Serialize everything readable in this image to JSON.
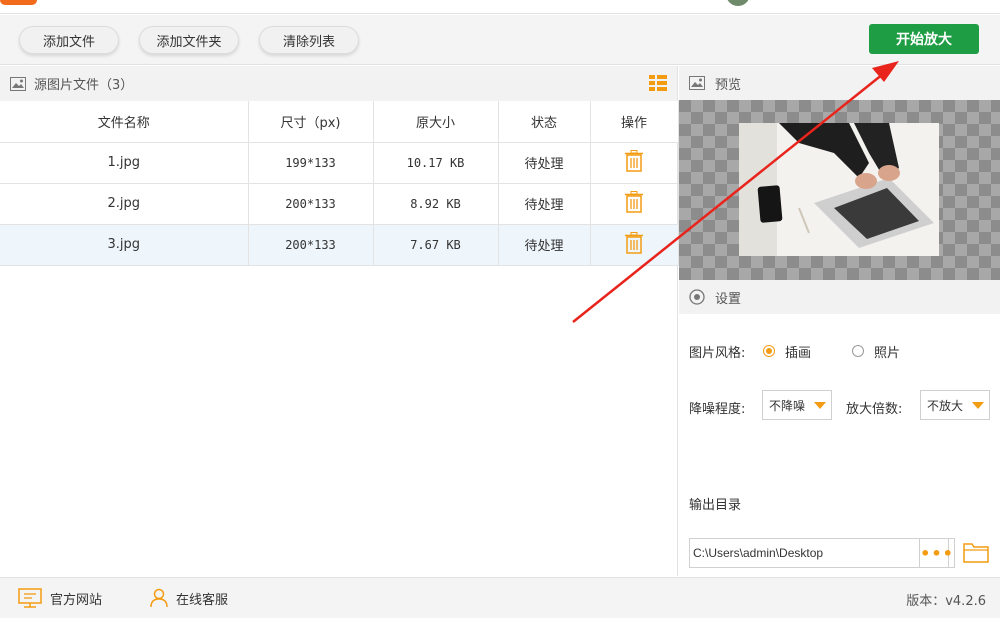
{
  "toolbar": {
    "add_file": "添加文件",
    "add_folder": "添加文件夹",
    "clear_list": "清除列表",
    "start": "开始放大"
  },
  "file_panel": {
    "title": "源图片文件（3）",
    "columns": [
      "文件名称",
      "尺寸（px)",
      "原大小",
      "状态",
      "操作"
    ],
    "rows": [
      {
        "name": "1.jpg",
        "size": "199*133",
        "filesize": "10.17 KB",
        "status": "待处理"
      },
      {
        "name": "2.jpg",
        "size": "200*133",
        "filesize": "8.92 KB",
        "status": "待处理"
      },
      {
        "name": "3.jpg",
        "size": "200*133",
        "filesize": "7.67 KB",
        "status": "待处理"
      }
    ]
  },
  "preview": {
    "title": "预览"
  },
  "settings": {
    "title": "设置",
    "style_label": "图片风格:",
    "style_options": [
      "插画",
      "照片"
    ],
    "style_selected": "插画",
    "noise_label": "降噪程度:",
    "noise_value": "不降噪",
    "scale_label": "放大倍数:",
    "scale_value": "不放大",
    "output_label": "输出目录",
    "output_path": "C:\\Users\\admin\\Desktop",
    "dots": "•••"
  },
  "footer": {
    "website": "官方网站",
    "support": "在线客服",
    "version": "版本：v4.2.6"
  },
  "colors": {
    "accent": "#1f9d44",
    "orange": "#f39c12",
    "arrow": "#e8241c"
  }
}
